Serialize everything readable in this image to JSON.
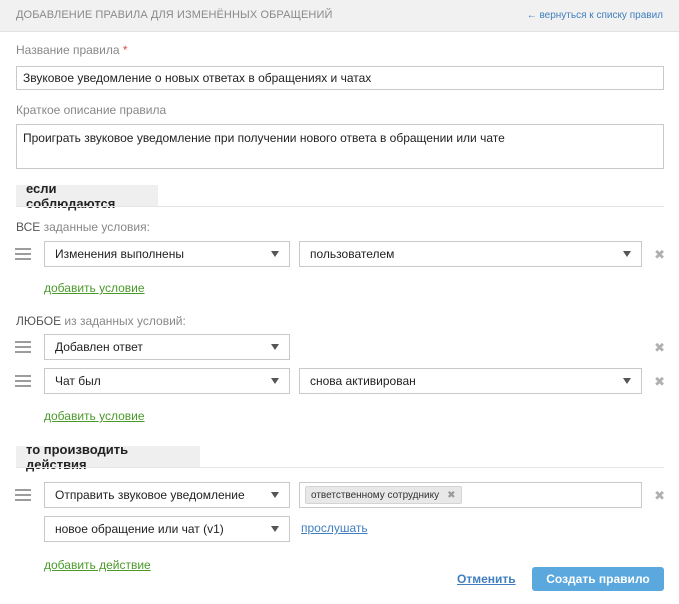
{
  "header": {
    "title": "Добавление правила для изменённых обращений",
    "back_link": "← вернуться к списку правил"
  },
  "form": {
    "name_label": "Название правила",
    "required_mark": "*",
    "name_value": "Звуковое уведомление о новых ответах в обращениях и чатах",
    "desc_label": "Краткое описание правила",
    "desc_value": "Проиграть звуковое уведомление при получении нового ответа в обращении или чате"
  },
  "conditions": {
    "section_title": "если соблюдаются",
    "all": {
      "label_strong": "ВСЕ",
      "label_rest": " заданные условия:",
      "rows": [
        {
          "field": "Изменения выполнены",
          "operand": "пользователем"
        }
      ],
      "add_link": "добавить условие"
    },
    "any": {
      "label_strong": "ЛЮБОЕ",
      "label_rest": " из заданных условий:",
      "rows": [
        {
          "field": "Добавлен ответ"
        },
        {
          "field": "Чат был",
          "operand": "снова активирован"
        }
      ],
      "add_link": "добавить условие"
    }
  },
  "actions": {
    "section_title": "то производить действия",
    "rows": [
      {
        "action": "Отправить звуковое уведомление",
        "tag": "ответственному сотруднику",
        "sound": "новое обращение или чат (v1)",
        "listen_link": "прослушать"
      }
    ],
    "add_link": "добавить действие"
  },
  "footer": {
    "cancel": "Отменить",
    "submit": "Создать правило"
  },
  "colors": {
    "accent_button": "#5aa8de",
    "link_blue": "#3f7fbf",
    "link_green": "#4a9a2a",
    "required": "#e04b4b"
  }
}
